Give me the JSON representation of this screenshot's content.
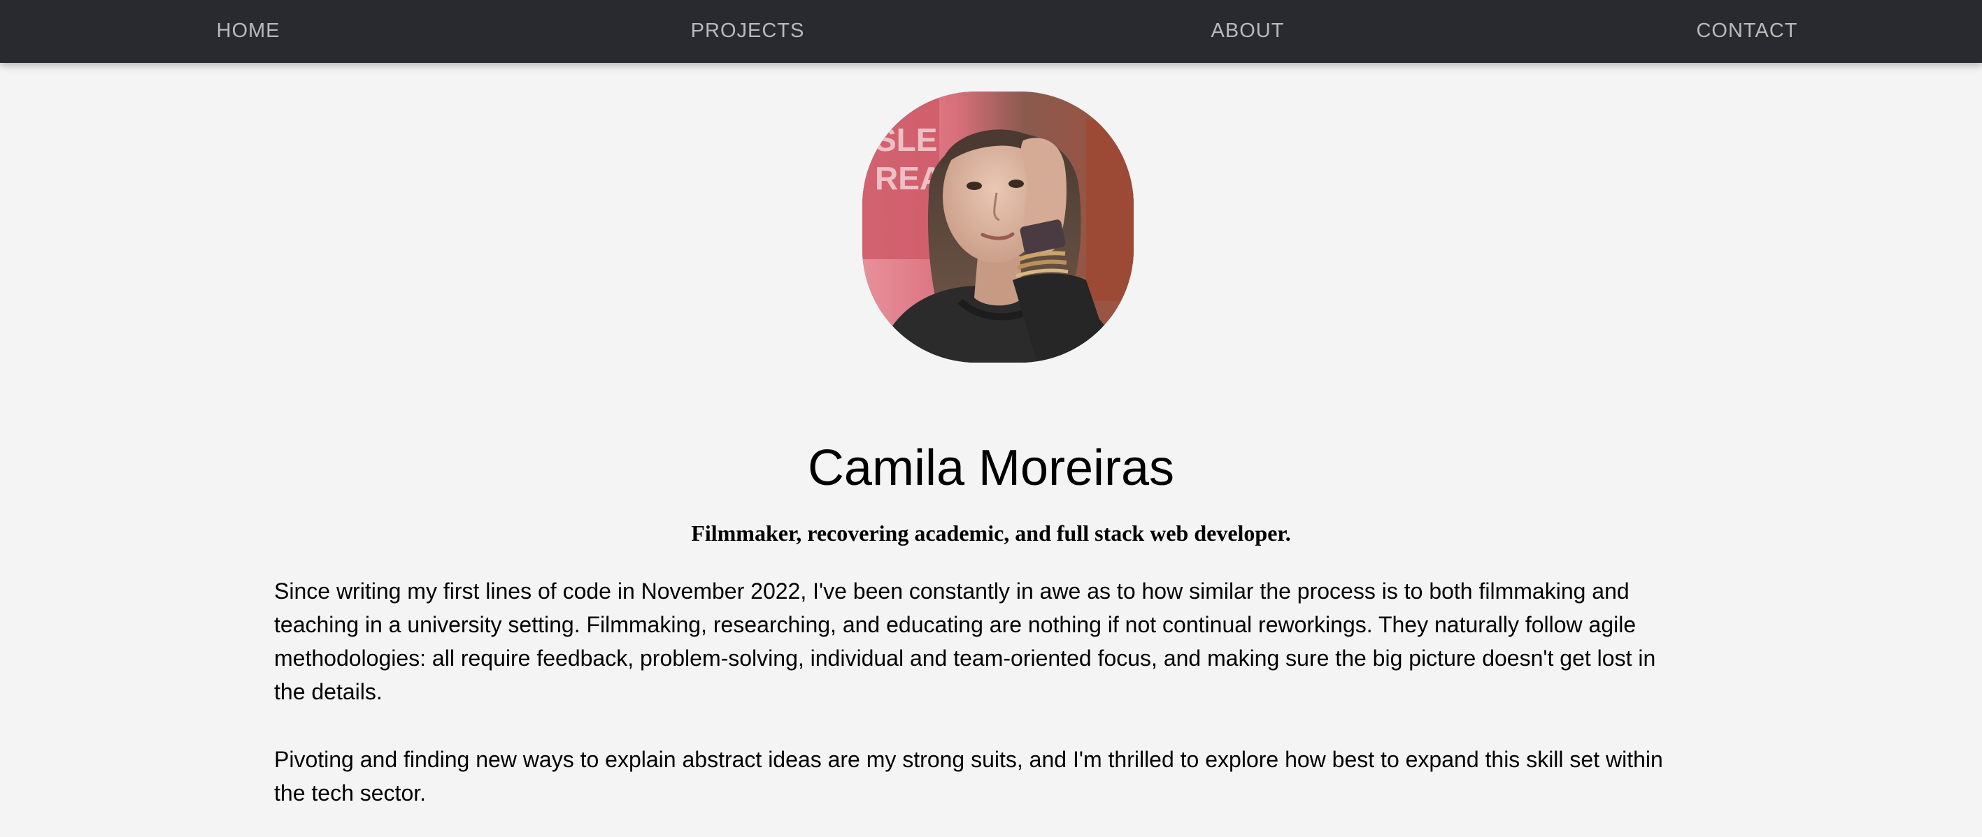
{
  "nav": {
    "home": "HOME",
    "projects": "PROJECTS",
    "about": "ABOUT",
    "contact": "CONTACT"
  },
  "profile": {
    "photo_icon": "portrait-photo",
    "name": "Camila Moreiras",
    "tagline": "Filmmaker, recovering academic, and full stack web developer."
  },
  "bio": {
    "paragraph_1": "Since writing my first lines of code in November 2022, I've been constantly in awe as to how similar the process is to both filmmaking and teaching in a university setting. Filmmaking, researching, and educating are nothing if not continual reworkings. They naturally follow agile methodologies: all require feedback, problem-solving, individual and team-oriented focus, and making sure the big picture doesn't get lost in the details.",
    "paragraph_2": "Pivoting and finding new ways to explain abstract ideas are my strong suits, and I'm thrilled to explore how best to expand this skill set within the tech sector."
  },
  "colors": {
    "navbar_bg": "#282a30",
    "nav_text": "#b9b9b9",
    "page_bg": "#f4f4f4",
    "text": "#000000"
  }
}
